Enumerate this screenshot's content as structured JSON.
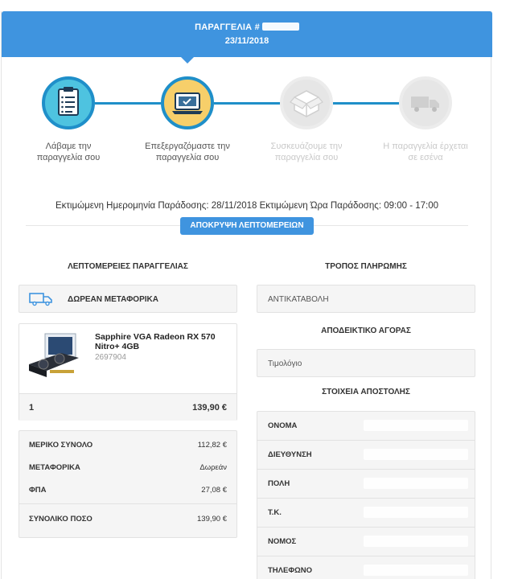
{
  "header": {
    "order_label": "ΠΑΡΑΓΓΕΛΙΑ #",
    "date": "23/11/2018"
  },
  "steps": [
    {
      "label_line1": "Λάβαμε την",
      "label_line2": "παραγγελία σου",
      "icon": "clipboard-icon",
      "state": "done"
    },
    {
      "label_line1": "Επεξεργαζόμαστε την",
      "label_line2": "παραγγελία σου",
      "icon": "laptop-icon",
      "state": "current"
    },
    {
      "label_line1": "Συσκευάζουμε την",
      "label_line2": "παραγγελία σου",
      "icon": "box-icon",
      "state": "pending"
    },
    {
      "label_line1": "Η παραγγελία έρχεται",
      "label_line2": "σε εσένα",
      "icon": "truck-icon",
      "state": "pending"
    }
  ],
  "delivery_info": "Εκτιμώμενη Ημερομηνία Παράδοσης: 28/11/2018 Εκτιμώμενη Ώρα Παράδοσης: 09:00 - 17:00",
  "toggle_details_label": "ΑΠΟΚΡΥΨΗ ΛΕΠΤΟΜΕΡΕΙΩΝ",
  "order_details": {
    "title": "ΛΕΠΤΟΜΕΡΕΙΕΣ ΠΑΡΑΓΓΕΛΙΑΣ",
    "shipping_badge": "ΔΩΡΕΑΝ ΜΕΤΑΦΟΡΙΚΑ",
    "product": {
      "name_line1": "Sapphire VGA Radeon RX 570",
      "name_line2": "Nitro+ 4GB",
      "code": "2697904",
      "quantity": "1",
      "price": "139,90 €"
    },
    "summary": [
      {
        "label": "ΜΕΡΙΚΟ ΣΥΝΟΛΟ",
        "value": "112,82 €"
      },
      {
        "label": "ΜΕΤΑΦΟΡΙΚΑ",
        "value": "Δωρεάν"
      },
      {
        "label": "ΦΠΑ",
        "value": "27,08 €"
      },
      {
        "label": "ΣΥΝΟΛΙΚΟ ΠΟΣΟ",
        "value": "139,90 €"
      }
    ]
  },
  "payment": {
    "title": "ΤΡΟΠΟΣ ΠΛΗΡΩΜΗΣ",
    "method": "ΑΝΤΙΚΑΤΑΒΟΛΗ"
  },
  "receipt": {
    "title": "ΑΠΟΔΕΙΚΤΙΚΟ ΑΓΟΡΑΣ",
    "value": "Τιμολόγιο"
  },
  "shipping": {
    "title": "ΣΤΟΙΧΕΙΑ ΑΠΟΣΤΟΛΗΣ",
    "fields": [
      "ΟΝΟΜΑ",
      "ΔΙΕΥΘΥΝΣΗ",
      "ΠΟΛΗ",
      "Τ.Κ.",
      "ΝΟΜΟΣ",
      "ΤΗΛΕΦΩΝΟ"
    ]
  },
  "colors": {
    "primary": "#3f94df",
    "step_line": "#1f8fc9",
    "step1_fill": "#4ec3e0",
    "step2_fill": "#f7cf6a",
    "pending": "#e6e6e6"
  }
}
